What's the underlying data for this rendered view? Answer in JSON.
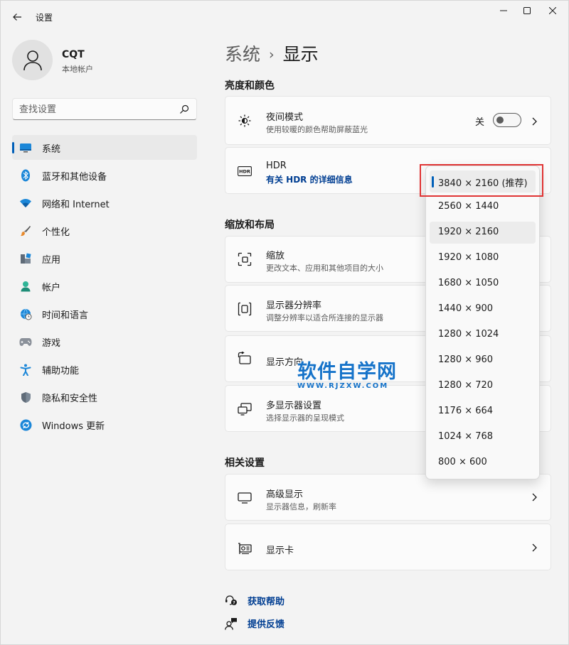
{
  "window": {
    "app_title": "设置"
  },
  "profile": {
    "name": "CQT",
    "account_type": "本地帐户"
  },
  "search": {
    "placeholder": "查找设置"
  },
  "sidebar": {
    "items": [
      {
        "label": "系统",
        "icon": "system-icon",
        "active": true
      },
      {
        "label": "蓝牙和其他设备",
        "icon": "bluetooth-icon"
      },
      {
        "label": "网络和 Internet",
        "icon": "wifi-icon"
      },
      {
        "label": "个性化",
        "icon": "brush-icon"
      },
      {
        "label": "应用",
        "icon": "apps-icon"
      },
      {
        "label": "帐户",
        "icon": "account-icon"
      },
      {
        "label": "时间和语言",
        "icon": "globe-clock-icon"
      },
      {
        "label": "游戏",
        "icon": "gamepad-icon"
      },
      {
        "label": "辅助功能",
        "icon": "accessibility-icon"
      },
      {
        "label": "隐私和安全性",
        "icon": "shield-icon"
      },
      {
        "label": "Windows 更新",
        "icon": "update-icon"
      }
    ]
  },
  "breadcrumb": {
    "parent": "系统",
    "separator": "›",
    "current": "显示"
  },
  "sections": {
    "brightness": "亮度和颜色",
    "scale_layout": "缩放和布局",
    "related": "相关设置"
  },
  "cards": {
    "night_light": {
      "title": "夜间模式",
      "subtitle": "使用较暖的颜色帮助屏蔽蓝光",
      "toggle_label": "关",
      "toggle_on": false
    },
    "hdr": {
      "title": "HDR",
      "link": "有关 HDR 的详细信息"
    },
    "scale": {
      "title": "缩放",
      "subtitle": "更改文本、应用和其他项目的大小"
    },
    "resolution": {
      "title": "显示器分辨率",
      "subtitle": "调整分辨率以适合所连接的显示器"
    },
    "orientation": {
      "title": "显示方向"
    },
    "multi_display": {
      "title": "多显示器设置",
      "subtitle": "选择显示器的呈现模式"
    },
    "advanced": {
      "title": "高级显示",
      "subtitle": "显示器信息，刷新率"
    },
    "graphics": {
      "title": "显示卡"
    }
  },
  "resolution_dropdown": {
    "selected": "3840 × 2160 (推荐)",
    "options": [
      "3840 × 2160 (推荐)",
      "2560 × 1440",
      "1920 × 2160",
      "1920 × 1080",
      "1680 × 1050",
      "1440 × 900",
      "1280 × 1024",
      "1280 × 960",
      "1280 × 720",
      "1176 × 664",
      "1024 × 768",
      "800 × 600"
    ]
  },
  "watermark": {
    "main": "软件自学网",
    "sub": "WWW.RJZXW.COM"
  },
  "footer": {
    "help": "获取帮助",
    "feedback": "提供反馈"
  },
  "colors": {
    "accent": "#005fb8",
    "link": "#003e92",
    "highlight_box": "#e03434",
    "watermark": "#1673c9"
  }
}
